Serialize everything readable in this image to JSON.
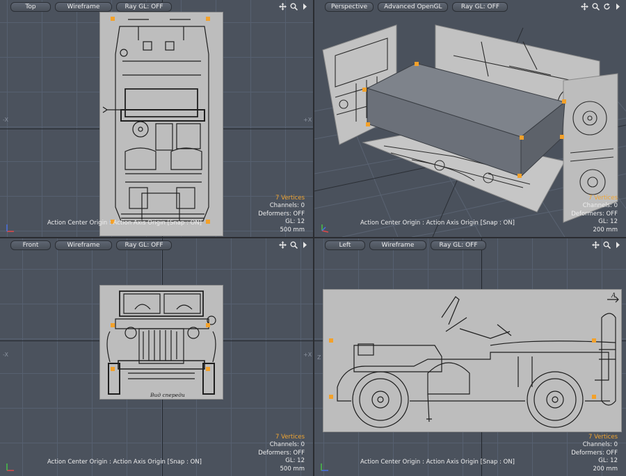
{
  "viewports": {
    "top": {
      "view": "Top",
      "mode": "Wireframe",
      "ray": "Ray GL: OFF",
      "vertices": "7 Vertices",
      "channels": "Channels: 0",
      "deformers": "Deformers: OFF",
      "gl": "GL: 12",
      "scale": "500 mm",
      "action": "Action Center Origin : Action Axis Origin  [Snap : ON]",
      "axis_left": "-X",
      "axis_right": "+X"
    },
    "perspective": {
      "view": "Perspective",
      "mode": "Advanced OpenGL",
      "ray": "Ray GL: OFF",
      "vertices": "7 Vertices",
      "channels": "Channels: 0",
      "deformers": "Deformers: OFF",
      "gl": "GL: 12",
      "scale": "200 mm",
      "action": "Action Center Origin : Action Axis Origin  [Snap : ON]"
    },
    "front": {
      "view": "Front",
      "mode": "Wireframe",
      "ray": "Ray GL: OFF",
      "vertices": "7 Vertices",
      "channels": "Channels: 0",
      "deformers": "Deformers: OFF",
      "gl": "GL: 12",
      "scale": "500 mm",
      "action": "Action Center Origin : Action Axis Origin  [Snap : ON]",
      "axis_left": "-X",
      "axis_right": "+X",
      "caption": "Вид спереди"
    },
    "left": {
      "view": "Left",
      "mode": "Wireframe",
      "ray": "Ray GL: OFF",
      "vertices": "7 Vertices",
      "channels": "Channels: 0",
      "deformers": "Deformers: OFF",
      "gl": "GL: 12",
      "scale": "200 mm",
      "action": "Action Center Origin : Action Axis Origin  [Snap : ON]",
      "axis_left": "Z",
      "marker": "A"
    }
  },
  "icons": [
    "move-icon",
    "zoom-icon",
    "rotate-icon",
    "maximize-icon"
  ],
  "colors": {
    "vertex": "#f3a12a",
    "viewport_bg": "#4b525d",
    "grid": "#566070",
    "selected_text": "#f0a532"
  }
}
